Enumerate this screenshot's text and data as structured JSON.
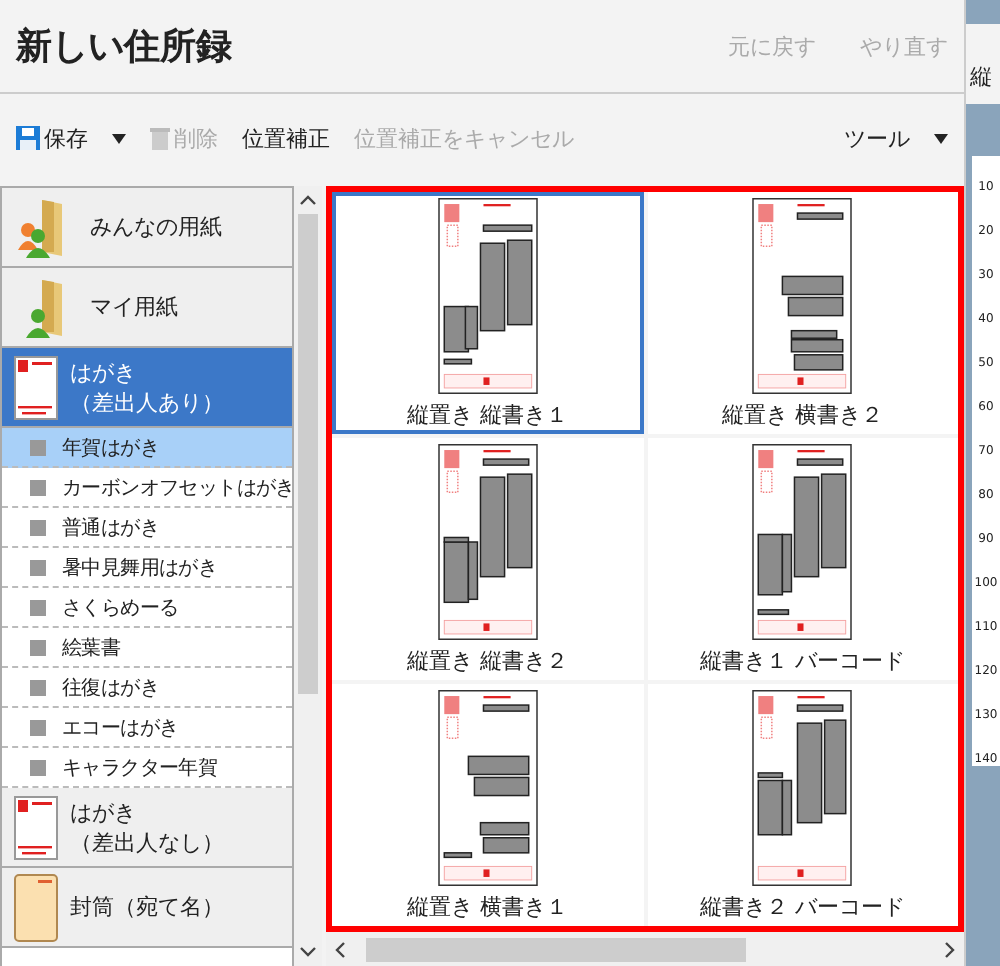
{
  "title": "新しい住所録",
  "header_actions": [
    {
      "label": "元に戻す",
      "disabled": true
    },
    {
      "label": "やり直す",
      "disabled": true
    }
  ],
  "toolbar": {
    "items": [
      {
        "kind": "save",
        "label": "保存",
        "disabled": false
      },
      {
        "kind": "delete",
        "label": "削除",
        "disabled": true
      },
      {
        "kind": "plain",
        "label": "位置補正",
        "disabled": false
      },
      {
        "kind": "plain",
        "label": "位置補正をキャンセル",
        "disabled": true
      }
    ],
    "menu": "ツール"
  },
  "categories": [
    {
      "kind": "shared-folder",
      "label": "みんなの用紙",
      "selected": false
    },
    {
      "kind": "my-folder",
      "label": "マイ用紙",
      "selected": false
    },
    {
      "kind": "postcard",
      "label": "はがき",
      "sublabel": "（差出人あり）",
      "selected": true,
      "expanded": true,
      "children": [
        {
          "label": "年賀はがき",
          "selected": true
        },
        {
          "label": "カーボンオフセットはがき",
          "selected": false
        },
        {
          "label": "普通はがき",
          "selected": false
        },
        {
          "label": "暑中見舞用はがき",
          "selected": false
        },
        {
          "label": "さくらめーる",
          "selected": false
        },
        {
          "label": "絵葉書",
          "selected": false
        },
        {
          "label": "往復はがき",
          "selected": false
        },
        {
          "label": "エコーはがき",
          "selected": false
        },
        {
          "label": "キャラクター年賀",
          "selected": false
        }
      ]
    },
    {
      "kind": "postcard",
      "label": "はがき",
      "sublabel": "（差出人なし）",
      "selected": false
    },
    {
      "kind": "envelope",
      "label": "封筒（宛て名）",
      "selected": false
    }
  ],
  "templates": [
    {
      "kind": "vertical-two-column",
      "label": "縦置き 縦書き１",
      "selected": true
    },
    {
      "kind": "horizontal-stacked",
      "label": "縦置き 横書き２",
      "selected": false
    },
    {
      "kind": "vertical-tall-sender",
      "label": "縦置き 縦書き２",
      "selected": false
    },
    {
      "kind": "vertical-barcode",
      "label": "縦書き１ バーコード",
      "selected": false
    },
    {
      "kind": "horizontal-spread",
      "label": "縦置き 横書き１",
      "selected": false
    },
    {
      "kind": "vertical-barcode-sender",
      "label": "縦書き２ バーコード",
      "selected": false
    }
  ],
  "side_panel": {
    "title": "縦",
    "ruler": [
      "10",
      "20",
      "30",
      "40",
      "50",
      "60",
      "70",
      "80",
      "90",
      "100",
      "110",
      "120",
      "130",
      "140"
    ]
  }
}
